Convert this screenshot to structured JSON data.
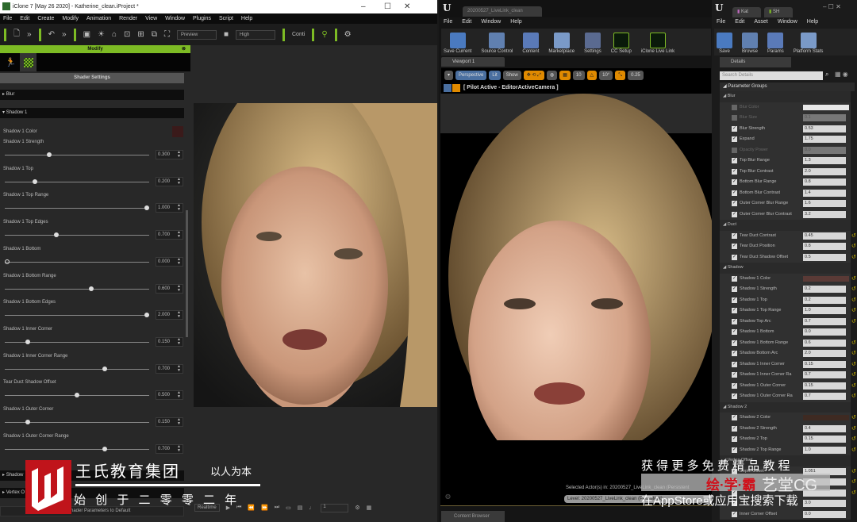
{
  "iclone": {
    "title": "iClone 7 [May 26 2020] - Katherine_clean.iProject *",
    "menu": [
      "File",
      "Edit",
      "Create",
      "Modify",
      "Animation",
      "Render",
      "View",
      "Window",
      "Plugins",
      "Script",
      "Help"
    ],
    "toolbar": {
      "preview": "Preview",
      "quality": "High",
      "conti": "Conti"
    },
    "modify_title": "Modify",
    "shader_settings": "Shader Settings",
    "groups": {
      "blur": "Blur",
      "shadow1": "Shadow 1",
      "shadow2": "Shadow",
      "vertex": "Vertex O"
    },
    "shadow1_color_label": "Shadow 1 Color",
    "shadow1_color": "#3a1a1a",
    "sliders": [
      {
        "label": "Shadow 1 Strength",
        "value": "0.300",
        "fraction": 0.3
      },
      {
        "label": "Shadow 1 Top",
        "value": "0.200",
        "fraction": 0.2
      },
      {
        "label": "Shadow 1 Top Range",
        "value": "1.000",
        "fraction": 1.0
      },
      {
        "label": "Shadow 1 Top Edges",
        "value": "0.700",
        "fraction": 0.35
      },
      {
        "label": "Shadow 1 Bottom",
        "value": "0.000",
        "fraction": 0.0
      },
      {
        "label": "Shadow 1 Bottom Range",
        "value": "0.600",
        "fraction": 0.6
      },
      {
        "label": "Shadow 1 Bottom Edges",
        "value": "2.000",
        "fraction": 1.0
      },
      {
        "label": "Shadow 1 Inner Corner",
        "value": "0.150",
        "fraction": 0.15
      },
      {
        "label": "Shadow 1 Inner Corner Range",
        "value": "0.700",
        "fraction": 0.7
      },
      {
        "label": "Tear Duct Shadow Offset",
        "value": "0.500",
        "fraction": 0.5
      },
      {
        "label": "Shadow 1 Outer Corner",
        "value": "0.150",
        "fraction": 0.15
      },
      {
        "label": "Shadow 1 Outer Corner Range",
        "value": "0.700",
        "fraction": 0.7
      }
    ],
    "reset_label": "Reset Shader Parameters to Default",
    "timeline": {
      "realtime": "Realtime",
      "frame": "1"
    },
    "accent": "#7dbb24"
  },
  "ue_main": {
    "tab": "20200527_LiveLink_clean",
    "menu": [
      "File",
      "Edit",
      "Window",
      "Help"
    ],
    "toolbar": [
      "Save Current",
      "Source Control",
      "Content",
      "Marketplace",
      "Settings",
      "CC Setup",
      "iClone Live Link"
    ],
    "viewport_tab": "Viewport 1",
    "viewport_bar": {
      "perspective": "Perspective",
      "lit": "Lit",
      "show": "Show",
      "grid": "10",
      "angle": "10°",
      "scale": "0.25"
    },
    "pilot": "[ Pilot Active - EditorActiveCamera ]",
    "selected": "Selected Actor(s) in:  20200527_LiveLink_clean (Persistent",
    "level": "Level:  20200527_LiveLink_clean (Persistent)",
    "content_browser": "Content Browser"
  },
  "ue_material": {
    "tabs": [
      "Kat",
      "SH"
    ],
    "menu": [
      "File",
      "Edit",
      "Asset",
      "Window",
      "Help"
    ],
    "toolbar": [
      "Save",
      "Browse",
      "Params",
      "Platform Stats"
    ],
    "details_tab": "Details",
    "search_placeholder": "Search Details",
    "parameter_groups": "Parameter Groups",
    "rows": [
      {
        "group": "Blur"
      },
      {
        "label": "Blur Color",
        "color": "#e8e8e8",
        "enabled": false
      },
      {
        "label": "Blur Size",
        "value": "0.1",
        "enabled": false
      },
      {
        "label": "Blur Strength",
        "value": "0.53",
        "enabled": true
      },
      {
        "label": "Expand",
        "value": "1.75",
        "enabled": true
      },
      {
        "label": "Opacity Power",
        "value": "8.0",
        "enabled": false
      },
      {
        "label": "Top Blur Range",
        "value": "1.3",
        "enabled": true
      },
      {
        "label": "Top Blur Contrast",
        "value": "2.0",
        "enabled": true
      },
      {
        "label": "Bottom Blur Range",
        "value": "0.8",
        "enabled": true
      },
      {
        "label": "Bottom Blur Contrast",
        "value": "1.4",
        "enabled": true
      },
      {
        "label": "Outer Corner Blur Range",
        "value": "1.6",
        "enabled": true
      },
      {
        "label": "Outer Corner Blur Contrast",
        "value": "3.2",
        "enabled": true
      },
      {
        "group": "Duct"
      },
      {
        "label": "Tear Duct Contrast",
        "value": "0.45",
        "enabled": true,
        "reset": true
      },
      {
        "label": "Tear Duct Position",
        "value": "0.8",
        "enabled": true,
        "reset": true
      },
      {
        "label": "Tear Duct Shadow Offset",
        "value": "0.5",
        "enabled": true,
        "reset": true
      },
      {
        "group": "Shadow"
      },
      {
        "label": "Shadow 1 Color",
        "color": "#5a3a36",
        "enabled": true,
        "reset": true
      },
      {
        "label": "Shadow 1 Strength",
        "value": "0.2",
        "enabled": true,
        "reset": true
      },
      {
        "label": "Shadow 1 Top",
        "value": "0.2",
        "enabled": true,
        "reset": true
      },
      {
        "label": "Shadow 1 Top Range",
        "value": "1.0",
        "enabled": true,
        "reset": true
      },
      {
        "label": "Shadow Top Arc",
        "value": "0.7",
        "enabled": true,
        "reset": true
      },
      {
        "label": "Shadow 1 Bottom",
        "value": "0.0",
        "enabled": true
      },
      {
        "label": "Shadow 1 Bottom Range",
        "value": "0.6",
        "enabled": true,
        "reset": true
      },
      {
        "label": "Shadow Bottom Arc",
        "value": "2.0",
        "enabled": true,
        "reset": true
      },
      {
        "label": "Shadow 1 Inner Corner",
        "value": "0.15",
        "enabled": true,
        "reset": true
      },
      {
        "label": "Shadow 1 Inner Corner Ra",
        "value": "0.7",
        "enabled": true,
        "reset": true
      },
      {
        "label": "Shadow 1 Outer Corner",
        "value": "0.15",
        "enabled": true,
        "reset": true
      },
      {
        "label": "Shadow 1 Outer Corner Ra",
        "value": "0.7",
        "enabled": true,
        "reset": true
      },
      {
        "group": "Shadow 2"
      },
      {
        "label": "Shadow 2 Color",
        "color": "#3e2a22",
        "enabled": true,
        "reset": true
      },
      {
        "label": "Shadow 2 Strength",
        "value": "0.4",
        "enabled": true,
        "reset": true
      },
      {
        "label": "Shadow 2 Top",
        "value": "0.15",
        "enabled": true,
        "reset": true
      },
      {
        "label": "Shadow 2 Top Range",
        "value": "1.0",
        "enabled": true,
        "reset": true
      },
      {
        "group": "Vertex Offset"
      },
      {
        "label": "Depth Offset",
        "value": "1.051",
        "enabled": true,
        "reset": true
      },
      {
        "label": "",
        "value": "",
        "enabled": true,
        "reset": true
      },
      {
        "label": "",
        "value": "",
        "enabled": true,
        "reset": true
      },
      {
        "label": "",
        "value": "3.0",
        "enabled": true
      },
      {
        "label": "Inner Corner Offset",
        "value": "0.0",
        "enabled": true
      }
    ]
  },
  "watermark": {
    "brand": "王氏教育集团",
    "motto": "以人为本",
    "since": "始 创 于 二 零 零 二 年",
    "promo": "获 得 更 多 免 费 精 品 教 程",
    "app_red": "绘·学·霸",
    "app_gray": "艺堂CG",
    "download": "在AppStore或应用宝搜索下载"
  }
}
